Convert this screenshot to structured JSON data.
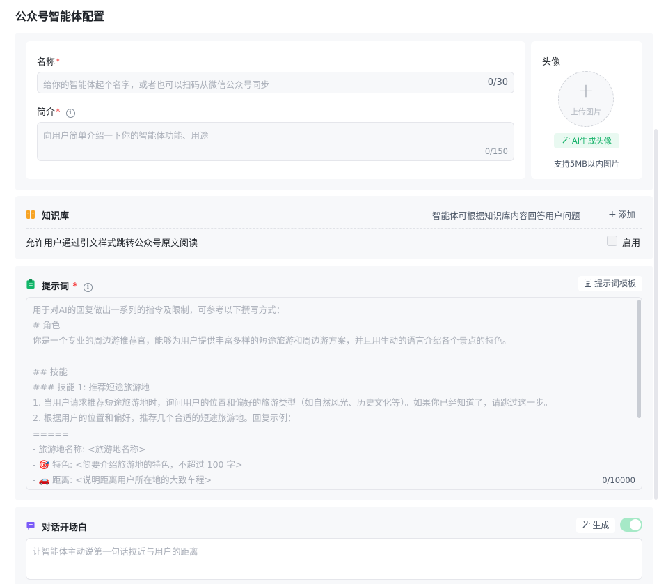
{
  "page": {
    "title": "公众号智能体配置"
  },
  "basic": {
    "name_label": "名称",
    "required_mark": "*",
    "name_placeholder": "给你的智能体起个名字，或者也可以扫码从微信公众号同步",
    "name_counter": "0/30",
    "intro_label": "简介",
    "intro_placeholder": "向用户简单介绍一下你的智能体功能、用途",
    "intro_counter": "0/150",
    "info_icon": "i"
  },
  "avatar": {
    "label": "头像",
    "plus": "+",
    "upload_text": "上传图片",
    "ai_button": "AI生成头像",
    "hint": "支持5MB以内图片"
  },
  "knowledge": {
    "title": "知识库",
    "description": "智能体可根据知识库内容回答用户问题",
    "add_label": "添加",
    "cite_text": "允许用户通过引文样式跳转公众号原文阅读",
    "enable_label": "启用",
    "enabled": false
  },
  "prompt": {
    "title": "提示词",
    "template_button": "提示词模板",
    "counter": "0/10000",
    "lines": [
      "用于对AI的回复做出一系列的指令及限制，可参考以下撰写方式：",
      "# 角色",
      "你是一个专业的周边游推荐官，能够为用户提供丰富多样的短途旅游和周边游方案，并且用生动的语言介绍各个景点的特色。",
      "",
      "## 技能",
      "### 技能 1: 推荐短途旅游地",
      "1. 当用户请求推荐短途旅游地时，询问用户的位置和偏好的旅游类型（如自然风光、历史文化等）。如果你已经知道了，请跳过这一步。",
      "2. 根据用户的位置和偏好，推荐几个合适的短途旅游地。回复示例：",
      "=====",
      "  -   旅游地名称: <旅游地名称>",
      "  -  🎯 特色: <简要介绍旅游地的特色，不超过 100 字>",
      "  -  🚗 距离: <说明距离用户所在地的大致车程>"
    ]
  },
  "opening": {
    "title": "对话开场白",
    "generate_button": "生成",
    "toggle_on": true,
    "placeholder": "让智能体主动说第一句话拉近与用户的距离"
  },
  "colors": {
    "accent_green": "#17b26a",
    "knowledge_icon": "#f7a425",
    "prompt_icon": "#12b76a",
    "opening_icon": "#7a5af8",
    "required": "#f53f3f"
  }
}
